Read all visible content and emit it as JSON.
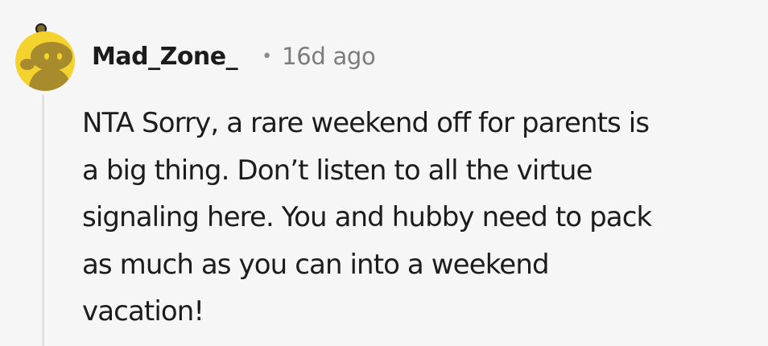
{
  "comment": {
    "author": "Mad_Zone_",
    "separator": "•",
    "time_ago": "16d ago",
    "avatar_icon": "snoo-avatar-icon",
    "avatar_color": "#f5d32e",
    "lines": [
      "NTA Sorry, a rare weekend off for parents is",
      "a big thing. Don’t listen to all the virtue",
      "signaling here. You and hubby need to pack",
      "as much as you can into a weekend",
      "vacation!"
    ]
  }
}
